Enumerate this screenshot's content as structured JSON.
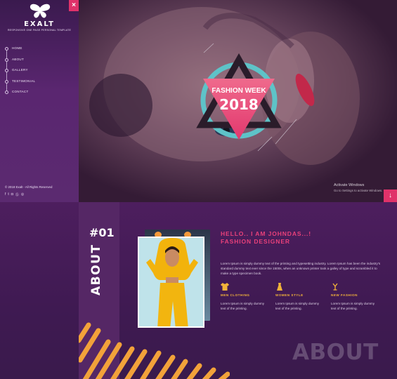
{
  "brand": {
    "name": "EXALT",
    "tagline": "RESPONSIVE ONE PAGE PERSONAL TEMPLATE"
  },
  "sidebar": {
    "items": [
      {
        "label": "HOME"
      },
      {
        "label": "ABOUT"
      },
      {
        "label": "GALLERY"
      },
      {
        "label": "TESTIMONIAL"
      },
      {
        "label": "CONTACT"
      }
    ],
    "copyright": "© 2018 Exalt - All Rights Reserved",
    "social": [
      "facebook-icon",
      "twitter-icon",
      "instagram-icon",
      "skype-icon",
      "dribbble-icon"
    ]
  },
  "hero": {
    "badge_line1": "FASHION WEEK",
    "badge_line2": "2018"
  },
  "watermark": {
    "line1": "Activate Windows",
    "line2": "Go to Settings to activate Windows."
  },
  "about": {
    "number": "#01",
    "vertical_label": "ABOUT",
    "big_label": "ABOUT",
    "hello_line1": "HELLO.. I AM JOHNDAS...!",
    "hello_line2": "FASHION DESIGNER",
    "body": "Lorem Ipsum is simply dummy text of the printing and typesetting industry. Lorem Ipsum has been the industry's standard dummy text ever since the 1500s, when an unknown printer took a galley of type and scrambled it to make a type specimen book.",
    "features": [
      {
        "icon": "shirt-icon",
        "title": "MEN CLOTHING",
        "desc": "Lorem Ipsum is simply dummy text of the printing."
      },
      {
        "icon": "dress-icon",
        "title": "WOMEN STYLE",
        "desc": "Lorem Ipsum is simply dummy text of the printing."
      },
      {
        "icon": "hanger-icon",
        "title": "NEW FASHION",
        "desc": "Lorem Ipsum is simply dummy text of the printing."
      }
    ]
  },
  "colors": {
    "accent": "#e0326a",
    "gold": "#f2b33a",
    "purple": "#5a2670"
  }
}
